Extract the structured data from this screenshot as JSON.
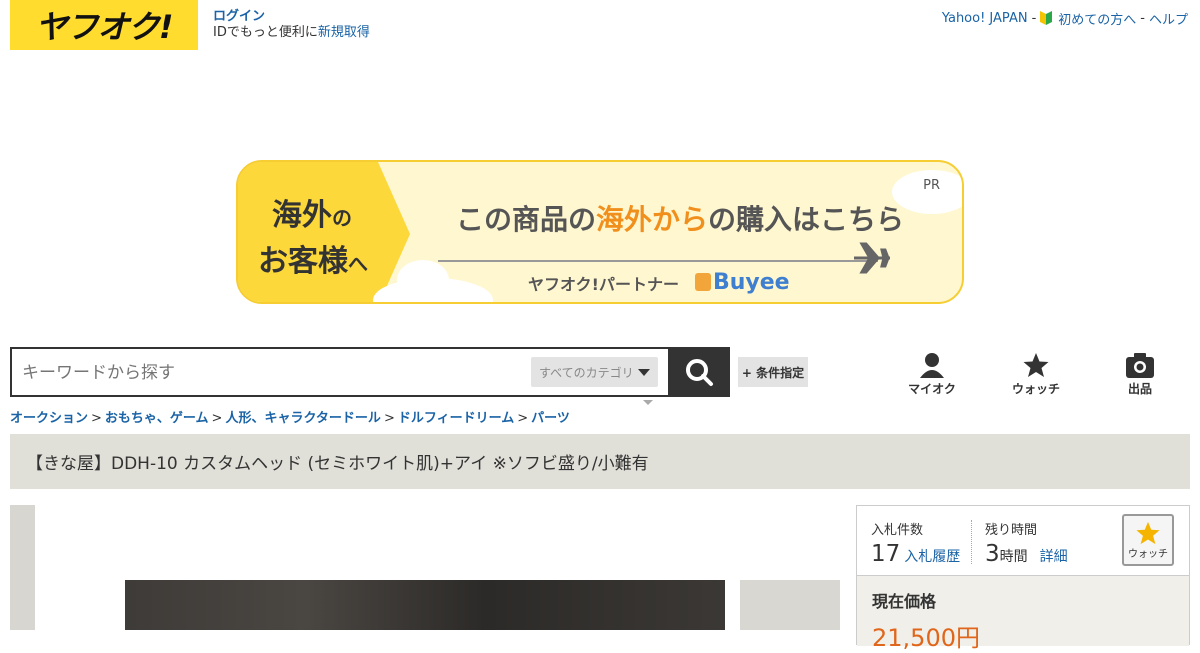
{
  "header": {
    "logo_text": "ヤフオク!",
    "login_label": "ログイン",
    "login_sub_text": "IDでもっと便利に",
    "signup_label": "新規取得",
    "top_links": {
      "yahoo_japan": "Yahoo! JAPAN",
      "beginners": "初めての方へ",
      "help": "ヘルプ"
    }
  },
  "banner": {
    "left_line1": "海外",
    "left_line1_small": "の",
    "left_line2": "お客様",
    "left_line2_small": "へ",
    "main_before": "この商品の",
    "main_accent": "海外から",
    "main_after": "の購入はこちら",
    "pr": "PR",
    "partner": "ヤフオク!パートナー",
    "buyee": "Buyee"
  },
  "search": {
    "placeholder": "キーワードから探す",
    "category": "すべてのカテゴリ",
    "conditions_label": "+ 条件指定"
  },
  "nav": {
    "my_auction": "マイオク",
    "watch": "ウォッチ",
    "sell": "出品"
  },
  "breadcrumb": [
    "オークション",
    "おもちゃ、ゲーム",
    "人形、キャラクタードール",
    "ドルフィードリーム",
    "パーツ"
  ],
  "item": {
    "title": "【きな屋】DDH-10 カスタムヘッド (セミホワイト肌)+アイ ※ソフビ盛り/小難有"
  },
  "bid": {
    "bids_label": "入札件数",
    "bids_count": "17",
    "bid_history_link": "入札履歴",
    "time_left_label": "残り時間",
    "time_left_value": "3",
    "time_left_unit": "時間",
    "details_link": "詳細",
    "watch_label": "ウォッチ",
    "current_price_label": "現在価格",
    "current_price": "21,500円"
  },
  "colors": {
    "brand_yellow": "#ffdc2e",
    "link_blue": "#1a63a6",
    "price_orange": "#e0661b",
    "title_bar": "#e0dfd8"
  }
}
